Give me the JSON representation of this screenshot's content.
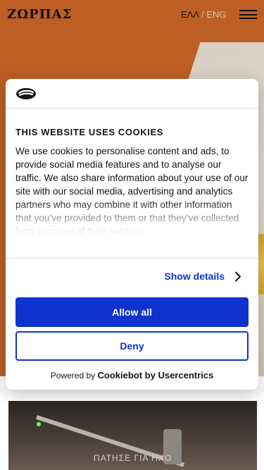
{
  "header": {
    "logo": "ΖΩΡΠΑΣ",
    "lang_active": "ΕΛΛ",
    "lang_sep": "/",
    "lang_other": "ENG",
    "menu_icon": "hamburger-icon"
  },
  "video": {
    "play_label": "ΠΑΤΗΣΕ ΓΙΑ ΗΧΟ"
  },
  "cookie_dialog": {
    "logo_icon": "cookiebot-icon",
    "title": "THIS WEBSITE USES COOKIES",
    "body": "We use cookies to personalise content and ads, to provide social media features and to analyse our traffic. We also share information about your use of our site with our social media, advertising and analytics partners who may combine it with other information that you’ve provided to them or that they’ve collected from your use of their services.",
    "show_details": "Show details",
    "allow_all": "Allow all",
    "deny": "Deny",
    "powered_prefix": "Powered by",
    "powered_brand": "Cookiebot by Usercentrics"
  },
  "colors": {
    "accent": "#1032cf",
    "hero_bg": "#bd5f24"
  }
}
